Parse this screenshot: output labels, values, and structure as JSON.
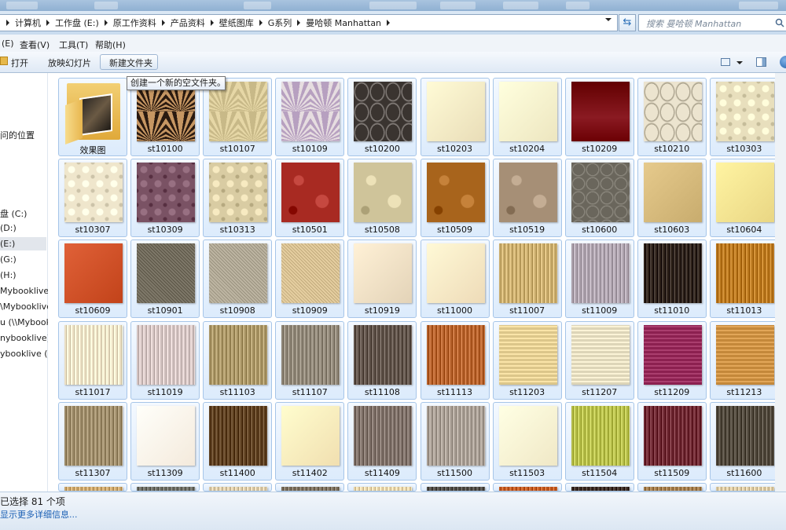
{
  "breadcrumbs": [
    "计算机",
    "工作盘 (E:)",
    "原工作资料",
    "产品资料",
    "壁纸图库",
    "G系列",
    "曼哈顿 Manhattan"
  ],
  "search": {
    "placeholder": "搜索 曼哈顿 Manhattan"
  },
  "menu": [
    "(E)",
    "查看(V)",
    "工具(T)",
    "帮助(H)"
  ],
  "toolbar": {
    "open_label": "打开",
    "slideshow_label": "放映幻灯片",
    "new_folder_label": "新建文件夹"
  },
  "tooltip": "创建一个新的空文件夹。",
  "nav": {
    "items": [
      "问的位置",
      "盘 (C:)",
      "(D:)",
      "(E:)",
      "(G:)",
      "(H:)",
      "Mybooklive)",
      "\\Mybooklive",
      "u (\\\\Mybook",
      "nybooklive)",
      "ybooklive (M"
    ]
  },
  "files": [
    {
      "name": "效果图",
      "type": "folder"
    },
    {
      "name": "st10100",
      "color": "#8a5a26",
      "pattern": "deco-gold"
    },
    {
      "name": "st10107",
      "color": "#e6d7a6",
      "pattern": "deco-light"
    },
    {
      "name": "st10109",
      "color": "#e6dde0",
      "pattern": "deco-lilac"
    },
    {
      "name": "st10200",
      "color": "#3a3430",
      "pattern": "trellis-dark"
    },
    {
      "name": "st10203",
      "color": "#e9ddb8",
      "pattern": "plain"
    },
    {
      "name": "st10204",
      "color": "#ede6c0",
      "pattern": "plain"
    },
    {
      "name": "st10209",
      "color": "#8a1a22",
      "pattern": "gradient-red"
    },
    {
      "name": "st10210",
      "color": "#ece4cf",
      "pattern": "trellis-light"
    },
    {
      "name": "st10303",
      "color": "#e8dfbd",
      "pattern": "hex"
    },
    {
      "name": "st10307",
      "color": "#efe6cc",
      "pattern": "hex"
    },
    {
      "name": "st10309",
      "color": "#7a5264",
      "pattern": "hex"
    },
    {
      "name": "st10313",
      "color": "#d9cca3",
      "pattern": "hex"
    },
    {
      "name": "st10501",
      "color": "#a82a22",
      "pattern": "floral"
    },
    {
      "name": "st10508",
      "color": "#cfc49a",
      "pattern": "floral"
    },
    {
      "name": "st10509",
      "color": "#a8641c",
      "pattern": "floral"
    },
    {
      "name": "st10519",
      "color": "#a68f76",
      "pattern": "floral"
    },
    {
      "name": "st10600",
      "color": "#6a665c",
      "pattern": "circles"
    },
    {
      "name": "st10603",
      "color": "#c8ac6e",
      "pattern": "plain"
    },
    {
      "name": "st10604",
      "color": "#e9d684",
      "pattern": "plain"
    },
    {
      "name": "st10609",
      "color": "#c2431a",
      "pattern": "plain"
    },
    {
      "name": "st10901",
      "color": "#7e7869",
      "pattern": "texture"
    },
    {
      "name": "st10908",
      "color": "#bdb5a2",
      "pattern": "texture"
    },
    {
      "name": "st10909",
      "color": "#e5cea0",
      "pattern": "texture"
    },
    {
      "name": "st10919",
      "color": "#e3d3b8",
      "pattern": "plain"
    },
    {
      "name": "st11000",
      "color": "#eedbb8",
      "pattern": "plain"
    },
    {
      "name": "st11007",
      "color": "#c9ac6c",
      "pattern": "stripes"
    },
    {
      "name": "st11009",
      "color": "#aca1ac",
      "pattern": "stripes"
    },
    {
      "name": "st11010",
      "color": "#2c2018",
      "pattern": "stripes"
    },
    {
      "name": "st11013",
      "color": "#b8761c",
      "pattern": "stripes"
    },
    {
      "name": "st11017",
      "color": "#ece0c4",
      "pattern": "stripes"
    },
    {
      "name": "st11019",
      "color": "#d2c2c0",
      "pattern": "stripes"
    },
    {
      "name": "st11103",
      "color": "#a89464",
      "pattern": "stripes"
    },
    {
      "name": "st11107",
      "color": "#8e8576",
      "pattern": "stripes"
    },
    {
      "name": "st11108",
      "color": "#5e5148",
      "pattern": "stripes"
    },
    {
      "name": "st11113",
      "color": "#b4602a",
      "pattern": "stripes"
    },
    {
      "name": "st11203",
      "color": "#dcc68a",
      "pattern": "weave"
    },
    {
      "name": "st11207",
      "color": "#ddd5b8",
      "pattern": "weave"
    },
    {
      "name": "st11209",
      "color": "#8c2050",
      "pattern": "weave"
    },
    {
      "name": "st11213",
      "color": "#c4883a",
      "pattern": "weave"
    },
    {
      "name": "st11307",
      "color": "#9c8a68",
      "pattern": "stripes"
    },
    {
      "name": "st11309",
      "color": "#f4eadc",
      "pattern": "plain"
    },
    {
      "name": "st11400",
      "color": "#5c3e1e",
      "pattern": "stripes"
    },
    {
      "name": "st11402",
      "color": "#f1dfb0",
      "pattern": "plain"
    },
    {
      "name": "st11409",
      "color": "#7c6e66",
      "pattern": "stripes"
    },
    {
      "name": "st11500",
      "color": "#a69c92",
      "pattern": "stripes"
    },
    {
      "name": "st11503",
      "color": "#f0e8c6",
      "pattern": "plain"
    },
    {
      "name": "st11504",
      "color": "#b4bc48",
      "pattern": "stripes"
    },
    {
      "name": "st11509",
      "color": "#6c2630",
      "pattern": "stripes"
    },
    {
      "name": "st11600",
      "color": "#4e463a",
      "pattern": "stripes"
    }
  ],
  "partial_row_colors": [
    "#c9a46a",
    "#6a6a62",
    "#d9c8a6",
    "#7a6e5c",
    "#e6d2a8",
    "#4e4a44",
    "#c05a20",
    "#3a2a22",
    "#a07a4a",
    "#d8c6a0"
  ],
  "details": {
    "count_text": "已选择 81 个项",
    "more_info": "显示更多详细信息..."
  },
  "colors": {
    "accent": "#1a5fb4",
    "tile_border": "#a6c5e8",
    "tile_fill": "#dcebfc"
  }
}
